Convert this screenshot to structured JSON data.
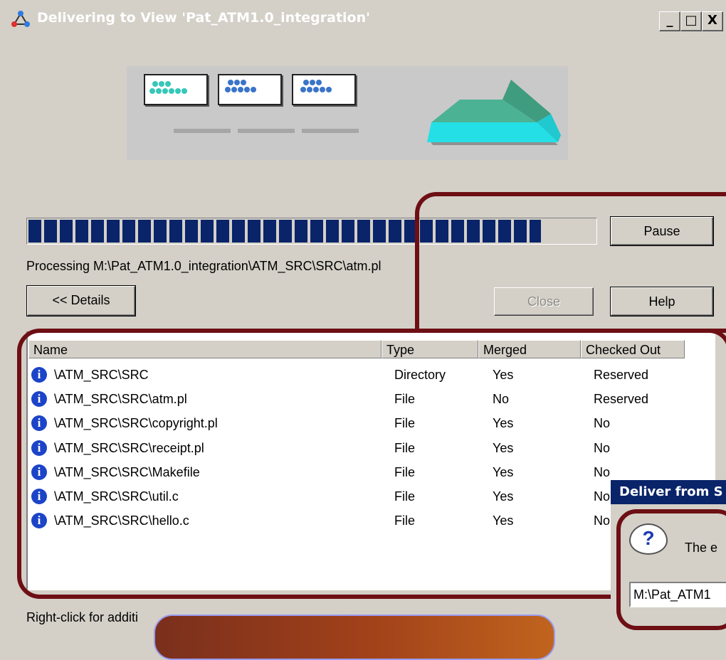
{
  "window": {
    "title": "Delivering to View 'Pat_ATM1.0_integration'",
    "controls": {
      "minimize": "_",
      "maximize": "□",
      "close": "X"
    }
  },
  "progress": {
    "fraction": 0.95,
    "status_text": "Processing M:\\Pat_ATM1.0_integration\\ATM_SRC\\SRC\\atm.pl"
  },
  "buttons": {
    "pause": "Pause",
    "details": "<< Details",
    "close": "Close",
    "help": "Help"
  },
  "table": {
    "columns": [
      "Name",
      "Type",
      "Merged",
      "Checked Out"
    ],
    "rows": [
      {
        "name": "\\ATM_SRC\\SRC",
        "type": "Directory",
        "merged": "Yes",
        "checked_out": "Reserved"
      },
      {
        "name": "\\ATM_SRC\\SRC\\atm.pl",
        "type": "File",
        "merged": "No",
        "checked_out": "Reserved"
      },
      {
        "name": "\\ATM_SRC\\SRC\\copyright.pl",
        "type": "File",
        "merged": "Yes",
        "checked_out": "No"
      },
      {
        "name": "\\ATM_SRC\\SRC\\receipt.pl",
        "type": "File",
        "merged": "Yes",
        "checked_out": "No"
      },
      {
        "name": "\\ATM_SRC\\SRC\\Makefile",
        "type": "File",
        "merged": "Yes",
        "checked_out": "No"
      },
      {
        "name": "\\ATM_SRC\\SRC\\util.c",
        "type": "File",
        "merged": "Yes",
        "checked_out": "No"
      },
      {
        "name": "\\ATM_SRC\\SRC\\hello.c",
        "type": "File",
        "merged": "Yes",
        "checked_out": "No"
      }
    ]
  },
  "footer_hint": "Right-click for additi",
  "popup": {
    "title": "Deliver from S",
    "message": "The e",
    "field_value": "M:\\Pat_ATM1"
  },
  "colors": {
    "highlight": "#6d0f14",
    "progress": "#0a246a",
    "selection_title": "#0a246a"
  }
}
